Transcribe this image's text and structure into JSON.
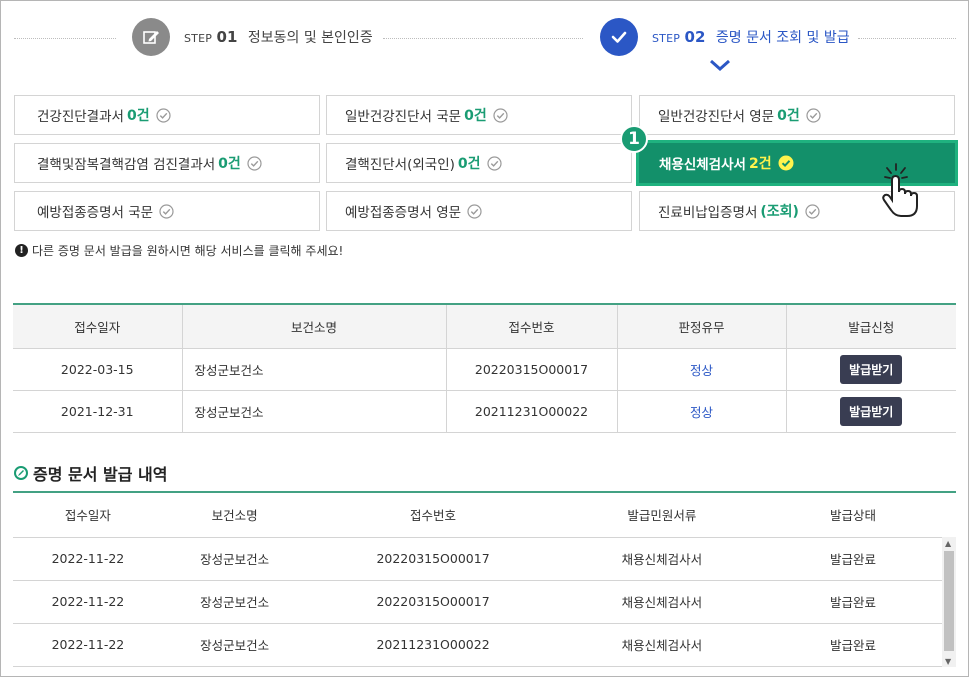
{
  "steps": [
    {
      "prefix": "STEP",
      "num": "01",
      "label": "정보동의 및 본인인증",
      "icon": "pencil-icon"
    },
    {
      "prefix": "STEP",
      "num": "02",
      "label": "증명 문서 조회 및 발급",
      "icon": "check-icon"
    }
  ],
  "documents": [
    {
      "label": "건강진단결과서",
      "count": "0건"
    },
    {
      "label": "일반건강진단서 국문",
      "count": "0건"
    },
    {
      "label": "일반건강진단서 영문",
      "count": "0건"
    },
    {
      "label": "결핵및잠복결핵감염 검진결과서",
      "count": "0건"
    },
    {
      "label": "결핵진단서(외국인)",
      "count": "0건"
    },
    {
      "label": "채용신체검사서",
      "count": "2건",
      "active": true
    },
    {
      "label": "예방접종증명서 국문",
      "count": ""
    },
    {
      "label": "예방접종증명서 영문",
      "count": ""
    },
    {
      "label": "진료비납입증명서",
      "count": "(조회)"
    }
  ],
  "badge": "1",
  "notice": {
    "icon": "!",
    "text": "다른 증명 문서 발급을 원하시면 해당 서비스를 클릭해 주세요!"
  },
  "table1": {
    "headers": [
      "접수일자",
      "보건소명",
      "접수번호",
      "판정유무",
      "발급신청"
    ],
    "rows": [
      [
        "2022-03-15",
        "장성군보건소",
        "20220315O00017",
        "정상",
        "발급받기"
      ],
      [
        "2021-12-31",
        "장성군보건소",
        "20211231O00022",
        "정상",
        "발급받기"
      ]
    ]
  },
  "section_title": "증명 문서 발급 내역",
  "table2": {
    "headers": [
      "접수일자",
      "보건소명",
      "접수번호",
      "발급민원서류",
      "발급상태"
    ],
    "rows": [
      [
        "2022-11-22",
        "장성군보건소",
        "20220315O00017",
        "채용신체검사서",
        "발급완료"
      ],
      [
        "2022-11-22",
        "장성군보건소",
        "20220315O00017",
        "채용신체검사서",
        "발급완료"
      ],
      [
        "2022-11-22",
        "장성군보건소",
        "20211231O00022",
        "채용신체검사서",
        "발급완료"
      ]
    ]
  },
  "colors": {
    "green": "#13906a",
    "blue": "#2b57c5",
    "button": "#393d52"
  }
}
